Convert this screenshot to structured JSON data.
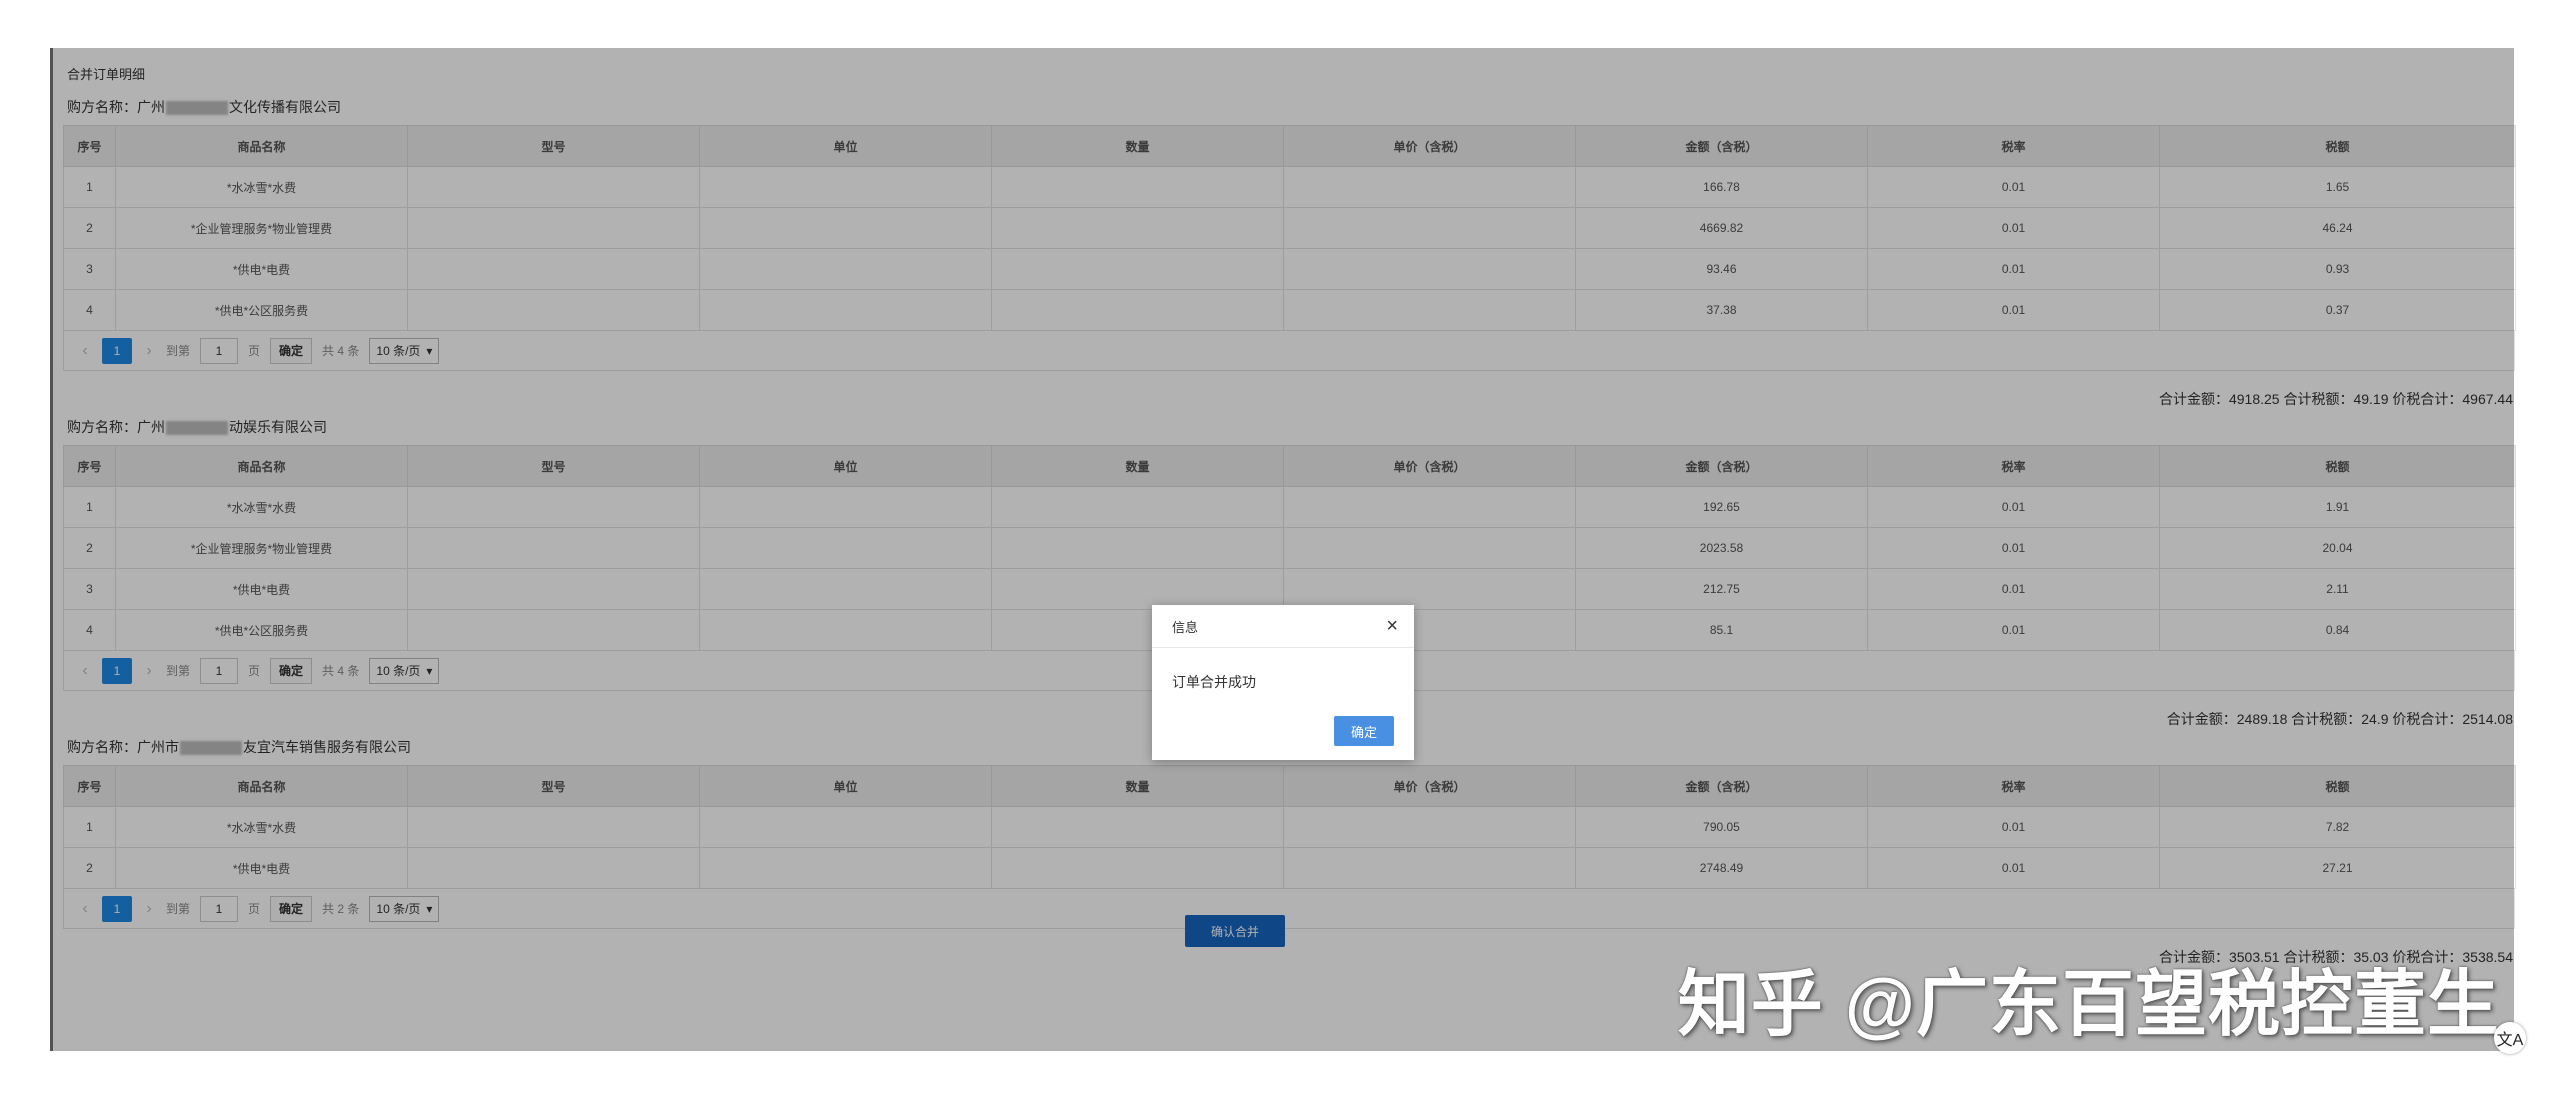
{
  "page_title": "合并订单明细",
  "columns": [
    "序号",
    "商品名称",
    "型号",
    "单位",
    "数量",
    "单价（含税）",
    "金额（含税）",
    "税率",
    "税额"
  ],
  "pager": {
    "prev": "‹",
    "next": "›",
    "current_page": "1",
    "goto_label": "到第",
    "goto_value": "1",
    "page_unit": "页",
    "confirm_label": "确定",
    "page_size": "10 条/页"
  },
  "groups": [
    {
      "buyer_prefix": "购方名称：广州",
      "buyer_suffix": "文化传播有限公司",
      "rows": [
        [
          "1",
          "*水冰雪*水费",
          "",
          "",
          "",
          "",
          "166.78",
          "0.01",
          "1.65"
        ],
        [
          "2",
          "*企业管理服务*物业管理费",
          "",
          "",
          "",
          "",
          "4669.82",
          "0.01",
          "46.24"
        ],
        [
          "3",
          "*供电*电费",
          "",
          "",
          "",
          "",
          "93.46",
          "0.01",
          "0.93"
        ],
        [
          "4",
          "*供电*公区服务费",
          "",
          "",
          "",
          "",
          "37.38",
          "0.01",
          "0.37"
        ]
      ],
      "total_label": "共 4 条",
      "summary": "合计金额：4918.25  合计税额：49.19  价税合计：4967.44"
    },
    {
      "buyer_prefix": "购方名称：广州",
      "buyer_suffix": "动娱乐有限公司",
      "rows": [
        [
          "1",
          "*水冰雪*水费",
          "",
          "",
          "",
          "",
          "192.65",
          "0.01",
          "1.91"
        ],
        [
          "2",
          "*企业管理服务*物业管理费",
          "",
          "",
          "",
          "",
          "2023.58",
          "0.01",
          "20.04"
        ],
        [
          "3",
          "*供电*电费",
          "",
          "",
          "",
          "",
          "212.75",
          "0.01",
          "2.11"
        ],
        [
          "4",
          "*供电*公区服务费",
          "",
          "",
          "",
          "",
          "85.1",
          "0.01",
          "0.84"
        ]
      ],
      "total_label": "共 4 条",
      "summary": "合计金额：2489.18  合计税额：24.9  价税合计：2514.08"
    },
    {
      "buyer_prefix": "购方名称：广州市",
      "buyer_suffix": "友宜汽车销售服务有限公司",
      "rows": [
        [
          "1",
          "*水冰雪*水费",
          "",
          "",
          "",
          "",
          "790.05",
          "0.01",
          "7.82"
        ],
        [
          "2",
          "*供电*电费",
          "",
          "",
          "",
          "",
          "2748.49",
          "0.01",
          "27.21"
        ]
      ],
      "total_label": "共 2 条",
      "summary": "合计金额：3503.51  合计税额：35.03  价税合计：3538.54"
    }
  ],
  "confirm_merge_label": "确认合并",
  "dialog": {
    "title": "信息",
    "message": "订单合并成功",
    "ok_label": "确定",
    "close": "×"
  },
  "watermark": "知乎 @广东百望税控董生",
  "accessibility_icon": "文A"
}
